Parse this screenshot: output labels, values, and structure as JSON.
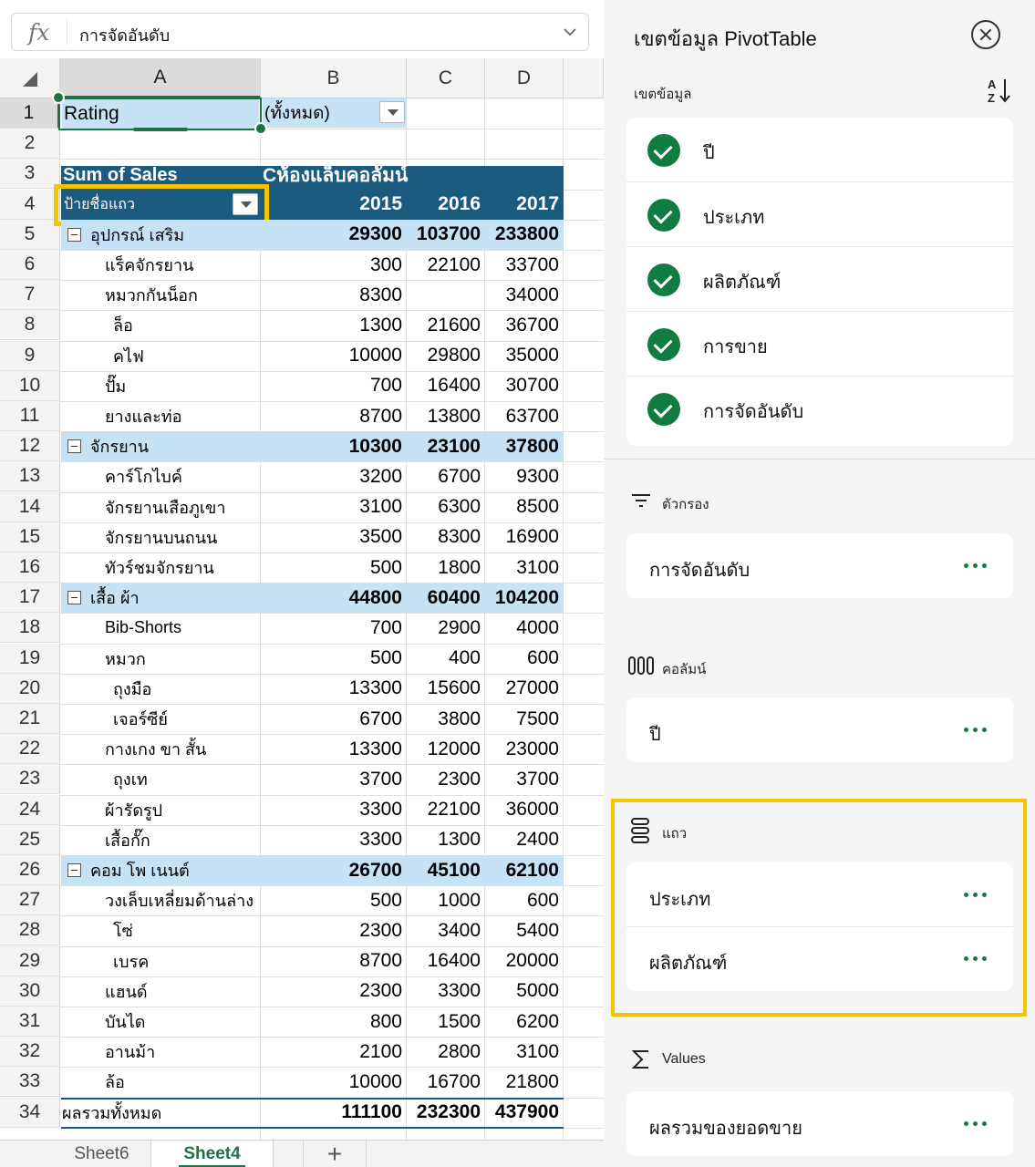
{
  "formula_bar": {
    "fx": "fx",
    "value": "การจัดอันดับ"
  },
  "columns": [
    "A",
    "B",
    "C",
    "D"
  ],
  "rows": [
    "1",
    "2",
    "3",
    "4",
    "5",
    "6",
    "7",
    "8",
    "9",
    "10",
    "11",
    "12",
    "13",
    "14",
    "15",
    "16",
    "17",
    "18",
    "19",
    "20",
    "21",
    "22",
    "23",
    "24",
    "25",
    "26",
    "27",
    "28",
    "29",
    "30",
    "31",
    "32",
    "33",
    "34"
  ],
  "filter_row": {
    "label": "Rating",
    "value": "(ทั้งหมด)"
  },
  "pivot": {
    "value_title": "Sum of Sales",
    "column_title": "Cห้องแล็บคอลัมน์",
    "row_label": "ป้ายชื่อแถว",
    "years": [
      "2015",
      "2016",
      "2017"
    ],
    "rows": [
      {
        "label": "อุปกรณ์ เสริม",
        "level": 0,
        "v2015": "29300",
        "v2016": "103700",
        "v2017": "233800"
      },
      {
        "label": "แร็คจักรยาน",
        "level": 1,
        "v2015": "300",
        "v2016": "22100",
        "v2017": "33700"
      },
      {
        "label": "หมวกกันน็อก",
        "level": 1,
        "v2015": "8300",
        "v2016": "",
        "v2017": "34000"
      },
      {
        "label": "ล็อ",
        "level": 2,
        "v2015": "1300",
        "v2016": "21600",
        "v2017": "36700"
      },
      {
        "label": "คไฟ",
        "level": 2,
        "v2015": "10000",
        "v2016": "29800",
        "v2017": "35000"
      },
      {
        "label": "ปั๊ม",
        "level": 1,
        "v2015": "700",
        "v2016": "16400",
        "v2017": "30700"
      },
      {
        "label": "ยางและท่อ",
        "level": 1,
        "v2015": "8700",
        "v2016": "13800",
        "v2017": "63700"
      },
      {
        "label": "จักรยาน",
        "level": 0,
        "v2015": "10300",
        "v2016": "23100",
        "v2017": "37800"
      },
      {
        "label": "คาร์โกไบค์",
        "level": 1,
        "v2015": "3200",
        "v2016": "6700",
        "v2017": "9300"
      },
      {
        "label": "จักรยานเสือภูเขา",
        "level": 1,
        "v2015": "3100",
        "v2016": "6300",
        "v2017": "8500"
      },
      {
        "label": "จักรยานบนถนน",
        "level": 1,
        "v2015": "3500",
        "v2016": "8300",
        "v2017": "16900"
      },
      {
        "label": "ทัวร์ชมจักรยาน",
        "level": 1,
        "v2015": "500",
        "v2016": "1800",
        "v2017": "3100"
      },
      {
        "label": "เสื้อ ผ้า",
        "level": 0,
        "v2015": "44800",
        "v2016": "60400",
        "v2017": "104200"
      },
      {
        "label": "Bib-Shorts",
        "level": 1,
        "v2015": "700",
        "v2016": "2900",
        "v2017": "4000"
      },
      {
        "label": "หมวก",
        "level": 1,
        "v2015": "500",
        "v2016": "400",
        "v2017": "600"
      },
      {
        "label": "ถุงมือ",
        "level": 2,
        "v2015": "13300",
        "v2016": "15600",
        "v2017": "27000"
      },
      {
        "label": "เจอร์ซีย์",
        "level": 2,
        "v2015": "6700",
        "v2016": "3800",
        "v2017": "7500"
      },
      {
        "label": "กางเกง ขา สั้น",
        "level": 1,
        "v2015": "13300",
        "v2016": "12000",
        "v2017": "23000"
      },
      {
        "label": "ถุงเท",
        "level": 2,
        "v2015": "3700",
        "v2016": "2300",
        "v2017": "3700"
      },
      {
        "label": "ผ้ารัดรูป",
        "level": 1,
        "v2015": "3300",
        "v2016": "22100",
        "v2017": "36000"
      },
      {
        "label": "เสื้อกั๊ก",
        "level": 1,
        "v2015": "3300",
        "v2016": "1300",
        "v2017": "2400"
      },
      {
        "label": "คอม โพ เนนต์",
        "level": 0,
        "v2015": "26700",
        "v2016": "45100",
        "v2017": "62100"
      },
      {
        "label": "วงเล็บเหลี่ยมด้านล่าง",
        "level": 1,
        "v2015": "500",
        "v2016": "1000",
        "v2017": "600"
      },
      {
        "label": "โซ่",
        "level": 2,
        "v2015": "2300",
        "v2016": "3400",
        "v2017": "5400"
      },
      {
        "label": "เบรค",
        "level": 2,
        "v2015": "8700",
        "v2016": "16400",
        "v2017": "20000"
      },
      {
        "label": "แฮนด์",
        "level": 1,
        "v2015": "2300",
        "v2016": "3300",
        "v2017": "5000"
      },
      {
        "label": "บันได",
        "level": 1,
        "v2015": "800",
        "v2016": "1500",
        "v2017": "6200"
      },
      {
        "label": "อานม้า",
        "level": 1,
        "v2015": "2100",
        "v2016": "2800",
        "v2017": "3100"
      },
      {
        "label": "ล้อ",
        "level": 1,
        "v2015": "10000",
        "v2016": "16700",
        "v2017": "21800"
      }
    ],
    "grand_total": {
      "label": "ผลรวมทั้งหมด",
      "v2015": "111100",
      "v2016": "232300",
      "v2017": "437900"
    }
  },
  "sheet_tabs": [
    "Sheet6",
    "Sheet4"
  ],
  "active_tab": "Sheet4",
  "add_sheet": "+",
  "panel": {
    "title": "เขตข้อมูล PivotTable",
    "fields_label": "เขตข้อมูล",
    "fields": [
      "ปี",
      "ประเภท",
      "ผลิตภัณฑ์",
      "การขาย",
      "การจัดอันดับ"
    ],
    "filters_label": "ตัวกรอง",
    "filters": [
      "การจัดอันดับ"
    ],
    "columns_label": "คอลัมน์",
    "columns": [
      "ปี"
    ],
    "rows_label": "แถว",
    "rows": [
      "ประเภท",
      "ผลิตภัณฑ์"
    ],
    "values_label": "Values",
    "values": [
      "ผลรวมของยอดขาย"
    ]
  },
  "colors": {
    "accent": "#107c41",
    "pivot_header": "#1b5b80",
    "pivot_band": "#c6e2f5",
    "highlight": "#f5c400"
  }
}
